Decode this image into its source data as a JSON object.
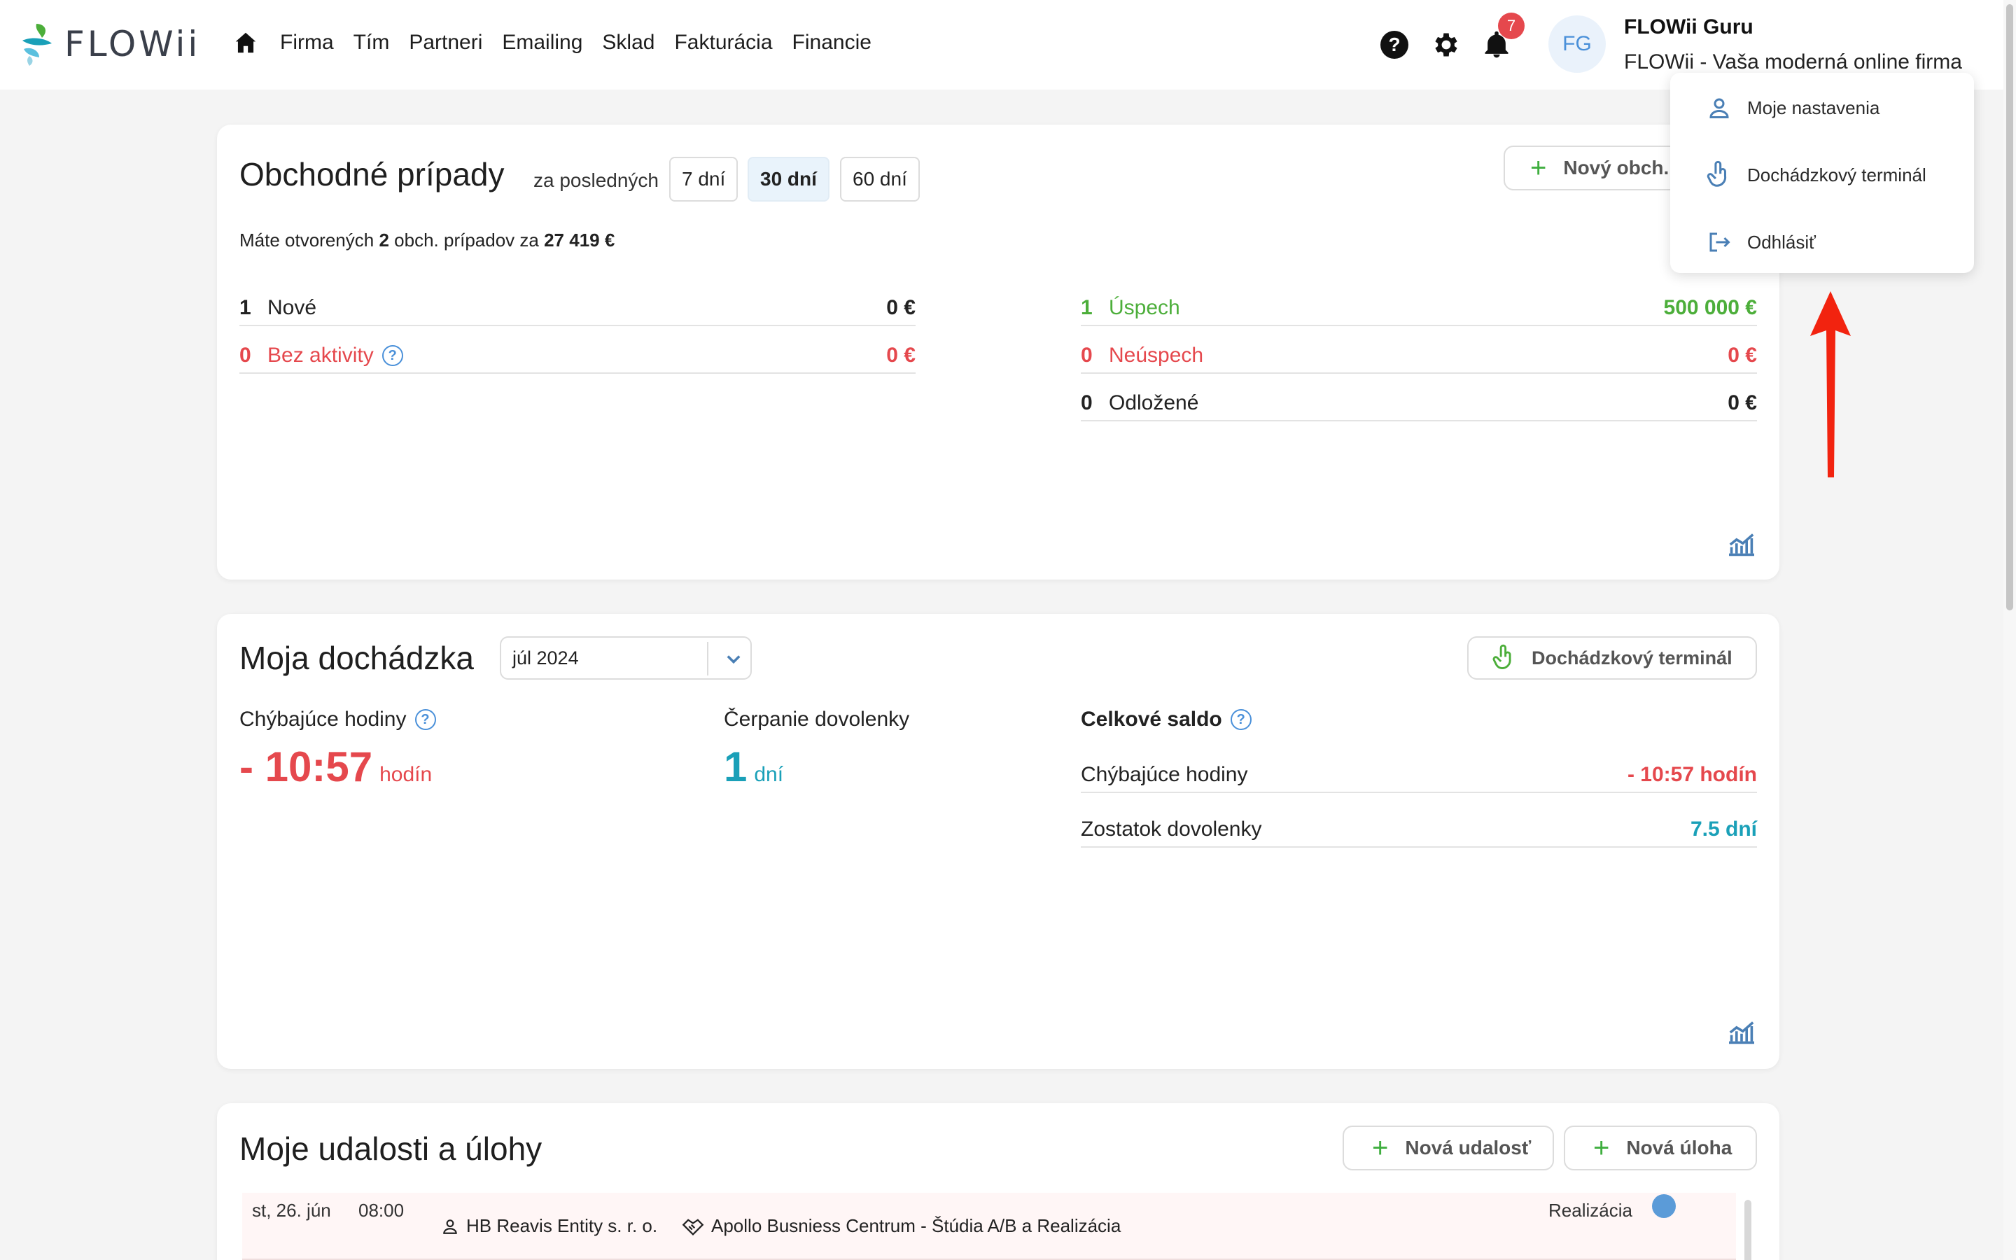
{
  "header": {
    "logo_text": "FLOWii",
    "nav": [
      "Firma",
      "Tím",
      "Partneri",
      "Emailing",
      "Sklad",
      "Fakturácia",
      "Financie"
    ],
    "help_label": "?",
    "notifications_count": "7",
    "avatar_initials": "FG",
    "user_name": "FLOWii Guru",
    "user_company": "FLOWii - Vaša moderná online firma"
  },
  "user_menu": {
    "items": [
      "Moje nastavenia",
      "Dochádzkový terminál",
      "Odhlásiť"
    ]
  },
  "deals": {
    "title": "Obchodné prípady",
    "period_label": "za posledných",
    "periods": [
      "7 dní",
      "30 dní",
      "60 dní"
    ],
    "new_button": "Nový obch.",
    "summary_prefix": "Máte otvorených",
    "summary_count": "2",
    "summary_mid": "obch. prípadov za",
    "summary_total": "27 419 €",
    "left_rows": [
      {
        "num": "1",
        "label": "Nové",
        "value": "0 €"
      },
      {
        "num": "0",
        "label": "Bez aktivity",
        "value": "0 €"
      }
    ],
    "right_rows": [
      {
        "num": "1",
        "label": "Úspech",
        "value": "500 000 €"
      },
      {
        "num": "0",
        "label": "Neúspech",
        "value": "0 €"
      },
      {
        "num": "0",
        "label": "Odložené",
        "value": "0 €"
      }
    ],
    "colors": {
      "green": "#4cae3a",
      "red": "#e5484d"
    }
  },
  "attendance": {
    "title": "Moja dochádzka",
    "month": "júl 2024",
    "terminal_button": "Dochádzkový terminál",
    "missing_label": "Chýbajúce hodiny",
    "missing_value": "- 10:57",
    "missing_unit": "hodín",
    "vacation_label": "Čerpanie dovolenky",
    "vacation_value": "1",
    "vacation_unit": "dní",
    "total_title": "Celkové saldo",
    "total_rows": [
      {
        "label": "Chýbajúce hodiny",
        "value": "- 10:57 hodín"
      },
      {
        "label": "Zostatok dovolenky",
        "value": "7.5 dní"
      }
    ]
  },
  "events": {
    "title": "Moje udalosti a úlohy",
    "new_event": "Nová udalosť",
    "new_task": "Nová úloha",
    "row": {
      "date": "st, 26. jún",
      "time": "08:00",
      "client": "HB Reavis Entity s. r. o.",
      "project": "Apollo Busniess Centrum - Štúdia A/B a Realizácia",
      "stage": "Realizácia"
    }
  }
}
